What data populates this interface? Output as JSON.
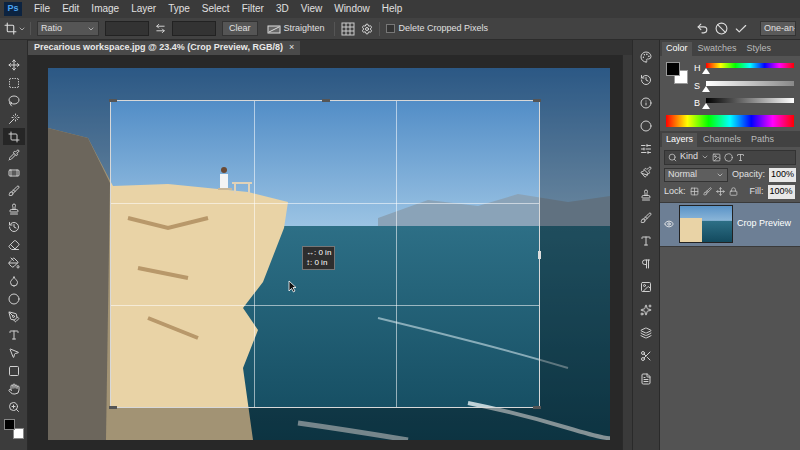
{
  "app": {
    "logo": "Ps"
  },
  "menu": [
    "File",
    "Edit",
    "Image",
    "Layer",
    "Type",
    "Select",
    "Filter",
    "3D",
    "View",
    "Window",
    "Help"
  ],
  "options_bar": {
    "ratio": "Ratio",
    "width": "",
    "height": "",
    "clear": "Clear",
    "straighten": "Straighten",
    "delete_cropped": {
      "label": "Delete Cropped Pixels",
      "checked": false
    },
    "workspace": "One-an-"
  },
  "document_tab": {
    "title": "Precarious workspace.jpg @ 23.4% (Crop Preview, RGB/8)",
    "close": "×"
  },
  "crop": {
    "tooltip": [
      "↔: 0 in",
      "↕: 0 in"
    ]
  },
  "color_panel": {
    "tabs": [
      {
        "label": "Color",
        "selected": true
      },
      {
        "label": "Swatches",
        "selected": false
      },
      {
        "label": "Styles",
        "selected": false
      }
    ],
    "sliders": [
      {
        "name": "H",
        "level": 0
      },
      {
        "name": "S",
        "level": 0
      },
      {
        "name": "B",
        "level": 0
      }
    ]
  },
  "layers_panel": {
    "tabs": [
      {
        "label": "Layers",
        "selected": true
      },
      {
        "label": "Channels",
        "selected": false
      },
      {
        "label": "Paths",
        "selected": false
      }
    ],
    "filter": "Kind",
    "blend_mode": "Normal",
    "opacity_label": "Opacity:",
    "opacity": "100%",
    "lock_label": "Lock:",
    "fill_label": "Fill:",
    "fill": "100%",
    "layers": [
      {
        "name": "Crop Preview",
        "visible": true,
        "selected": true
      }
    ]
  }
}
